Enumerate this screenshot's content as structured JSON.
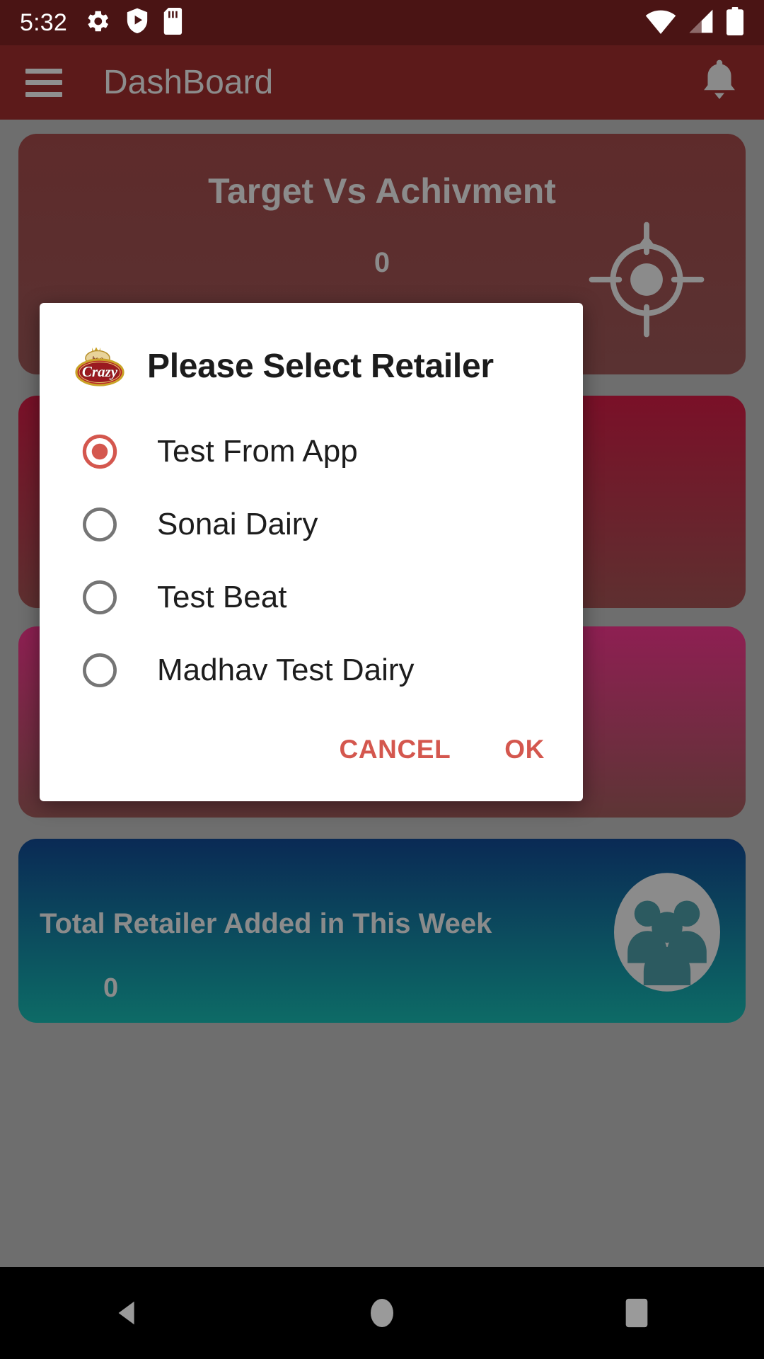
{
  "status_bar": {
    "clock": "5:32",
    "icons": [
      "gear-icon",
      "shield-play-icon",
      "sd-card-icon",
      "wifi-icon",
      "signal-icon",
      "battery-icon"
    ]
  },
  "app_bar": {
    "menu_icon": "hamburger-menu-icon",
    "title": "DashBoard",
    "notification_icon": "bell-icon"
  },
  "dashboard": {
    "cards": [
      {
        "title": "Target Vs Achivment",
        "value": "0",
        "icon": "target-crosshair-icon"
      },
      {
        "title": "",
        "value": "",
        "icon": ""
      },
      {
        "title": "",
        "value": "",
        "icon": ""
      },
      {
        "title": "Total Retailer Added in This Week",
        "value": "0",
        "icon": "people-group-icon"
      }
    ]
  },
  "dialog": {
    "logo": {
      "icon": "crazy-brand-logo",
      "top_text": "be a",
      "main_text": "Crazy"
    },
    "title": "Please Select Retailer",
    "options": [
      {
        "label": "Test From App",
        "selected": true
      },
      {
        "label": "Sonai Dairy",
        "selected": false
      },
      {
        "label": "Test Beat",
        "selected": false
      },
      {
        "label": "Madhav Test Dairy",
        "selected": false
      }
    ],
    "cancel_label": "CANCEL",
    "ok_label": "OK"
  },
  "nav_bar": {
    "back_icon": "back-triangle-icon",
    "home_icon": "home-circle-icon",
    "recents_icon": "recents-square-icon"
  },
  "colors": {
    "accent_red": "#d4574e",
    "app_bar": "#5c1a1a",
    "status_bar": "#4a1414",
    "scrim": "#6e6e6e",
    "radio_unselected": "#757575",
    "dialog_bg": "#ffffff",
    "title_text": "#1c1c1c"
  }
}
